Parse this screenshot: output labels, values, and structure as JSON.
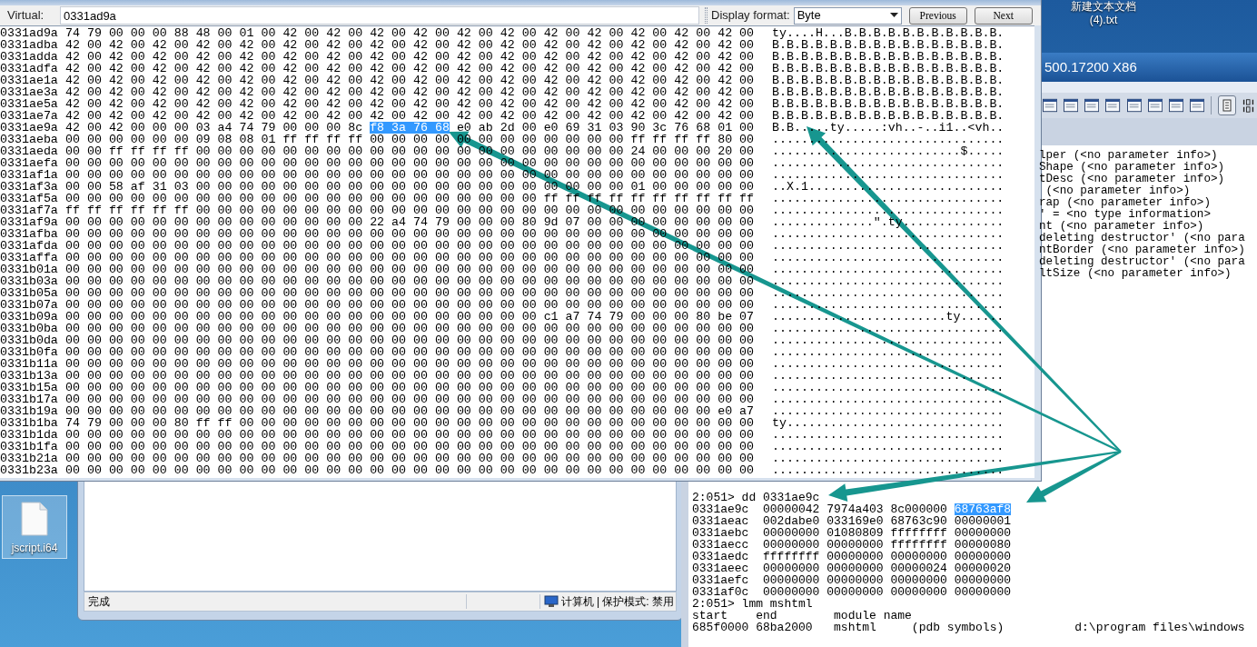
{
  "desktop_icons": [
    {
      "label_lines": [
        "新建文本文档",
        "(4).txt"
      ]
    }
  ],
  "debugger": {
    "title": "500.17200 X86",
    "symbol_lines": [
      "lper (<no parameter info>)",
      "Shape (<no parameter info>)",
      "tDesc (<no parameter info>)",
      " (<no parameter info>)",
      "rap (<no parameter info>)",
      "' = <no type information>",
      "nt (<no parameter info>)",
      "deleting destructor' (<no para",
      "ntBorder (<no parameter info>)",
      "deleting destructor' (<no para",
      "ltSize (<no parameter info>)"
    ],
    "command_lines": [
      {
        "kind": "prompt",
        "text": "2:051> dd 0331ae9c"
      },
      {
        "kind": "dump",
        "address": "0331ae9c",
        "values": [
          {
            "text": "00000042",
            "selected": false
          },
          {
            "text": "7974a403",
            "selected": false
          },
          {
            "text": "8c000000",
            "selected": false
          },
          {
            "text": "68763af8",
            "selected": true
          }
        ]
      },
      {
        "kind": "dump",
        "address": "0331aeac",
        "values": [
          {
            "text": "002dabe0",
            "selected": false
          },
          {
            "text": "033169e0",
            "selected": false
          },
          {
            "text": "68763c90",
            "selected": false
          },
          {
            "text": "00000001",
            "selected": false
          }
        ]
      },
      {
        "kind": "dump",
        "address": "0331aebc",
        "values": [
          {
            "text": "00000000",
            "selected": false
          },
          {
            "text": "01080809",
            "selected": false
          },
          {
            "text": "ffffffff",
            "selected": false
          },
          {
            "text": "00000000",
            "selected": false
          }
        ]
      },
      {
        "kind": "dump",
        "address": "0331aecc",
        "values": [
          {
            "text": "00000000",
            "selected": false
          },
          {
            "text": "00000000",
            "selected": false
          },
          {
            "text": "ffffffff",
            "selected": false
          },
          {
            "text": "00000080",
            "selected": false
          }
        ]
      },
      {
        "kind": "dump",
        "address": "0331aedc",
        "values": [
          {
            "text": "ffffffff",
            "selected": false
          },
          {
            "text": "00000000",
            "selected": false
          },
          {
            "text": "00000000",
            "selected": false
          },
          {
            "text": "00000000",
            "selected": false
          }
        ]
      },
      {
        "kind": "dump",
        "address": "0331aeec",
        "values": [
          {
            "text": "00000000",
            "selected": false
          },
          {
            "text": "00000000",
            "selected": false
          },
          {
            "text": "00000024",
            "selected": false
          },
          {
            "text": "00000020",
            "selected": false
          }
        ]
      },
      {
        "kind": "dump",
        "address": "0331aefc",
        "values": [
          {
            "text": "00000000",
            "selected": false
          },
          {
            "text": "00000000",
            "selected": false
          },
          {
            "text": "00000000",
            "selected": false
          },
          {
            "text": "00000000",
            "selected": false
          }
        ]
      },
      {
        "kind": "dump",
        "address": "0331af0c",
        "values": [
          {
            "text": "00000000",
            "selected": false
          },
          {
            "text": "00000000",
            "selected": false
          },
          {
            "text": "00000000",
            "selected": false
          },
          {
            "text": "00000000",
            "selected": false
          }
        ]
      },
      {
        "kind": "prompt",
        "text": "2:051> lmm mshtml"
      },
      {
        "kind": "text",
        "text": "start    end        module name"
      },
      {
        "kind": "text",
        "text": "685f0000 68ba2000   mshtml     (pdb symbols)          d:\\program files\\windows"
      }
    ]
  },
  "browser_window": {
    "status": "完成",
    "zone": "计算机 | 保护模式: 禁用"
  },
  "desktop_icon": {
    "label": "jscript.i64",
    "selected": true
  },
  "memory_window": {
    "address_label": "Virtual:",
    "address_value": "0331ad9a",
    "format_label": "Display format:",
    "format_value": "Byte",
    "buttons": [
      "Previous",
      "Next"
    ],
    "rows": [
      {
        "address": "0331ad9a",
        "hex": [
          {
            "text": "74 79 00 00 00 88 48 00 01 00 42 00 42 00 42 00 42 00 42 00 42 00 42 00 42 00 42 00 42 00 42 00",
            "selected": false
          }
        ],
        "ascii": "ty....H...B.B.B.B.B.B.B.B.B.B.B."
      },
      {
        "address": "0331adba",
        "hex": [
          {
            "text": "42 00 42 00 42 00 42 00 42 00 42 00 42 00 42 00 42 00 42 00 42 00 42 00 42 00 42 00 42 00 42 00",
            "selected": false
          }
        ],
        "ascii": "B.B.B.B.B.B.B.B.B.B.B.B.B.B.B.B."
      },
      {
        "address": "0331adda",
        "hex": [
          {
            "text": "42 00 42 00 42 00 42 00 42 00 42 00 42 00 42 00 42 00 42 00 42 00 42 00 42 00 42 00 42 00 42 00",
            "selected": false
          }
        ],
        "ascii": "B.B.B.B.B.B.B.B.B.B.B.B.B.B.B.B."
      },
      {
        "address": "0331adfa",
        "hex": [
          {
            "text": "42 00 42 00 42 00 42 00 42 00 42 00 42 00 42 00 42 00 42 00 42 00 42 00 42 00 42 00 42 00 42 00",
            "selected": false
          }
        ],
        "ascii": "B.B.B.B.B.B.B.B.B.B.B.B.B.B.B.B."
      },
      {
        "address": "0331ae1a",
        "hex": [
          {
            "text": "42 00 42 00 42 00 42 00 42 00 42 00 42 00 42 00 42 00 42 00 42 00 42 00 42 00 42 00 42 00 42 00",
            "selected": false
          }
        ],
        "ascii": "B.B.B.B.B.B.B.B.B.B.B.B.B.B.B.B."
      },
      {
        "address": "0331ae3a",
        "hex": [
          {
            "text": "42 00 42 00 42 00 42 00 42 00 42 00 42 00 42 00 42 00 42 00 42 00 42 00 42 00 42 00 42 00 42 00",
            "selected": false
          }
        ],
        "ascii": "B.B.B.B.B.B.B.B.B.B.B.B.B.B.B.B."
      },
      {
        "address": "0331ae5a",
        "hex": [
          {
            "text": "42 00 42 00 42 00 42 00 42 00 42 00 42 00 42 00 42 00 42 00 42 00 42 00 42 00 42 00 42 00 42 00",
            "selected": false
          }
        ],
        "ascii": "B.B.B.B.B.B.B.B.B.B.B.B.B.B.B.B."
      },
      {
        "address": "0331ae7a",
        "hex": [
          {
            "text": "42 00 42 00 42 00 42 00 42 00 42 00 42 00 42 00 42 00 42 00 42 00 42 00 42 00 42 00 42 00 42 00",
            "selected": false
          }
        ],
        "ascii": "B.B.B.B.B.B.B.B.B.B.B.B.B.B.B.B."
      },
      {
        "address": "0331ae9a",
        "hex": [
          {
            "text": "42 00 42 00 00 00 03 a4 74 79 00 00 00 8c",
            "selected": false
          },
          {
            "text": "f8 3a 76 68",
            "selected": true
          },
          {
            "text": "e0 ab 2d 00 e0 69 31 03 90 3c 76 68 01 00",
            "selected": false
          }
        ],
        "ascii": "B.B.....ty.....:vh..-..i1..<vh.."
      },
      {
        "address": "0331aeba",
        "hex": [
          {
            "text": "00 00 00 00 00 00 09 08 08 01 ff ff ff ff 00 00 00 00 00 00 00 00 00 00 00 00 ff ff ff ff 80 00",
            "selected": false
          }
        ],
        "ascii": "................................"
      },
      {
        "address": "0331aeda",
        "hex": [
          {
            "text": "00 00 ff ff ff ff 00 00 00 00 00 00 00 00 00 00 00 00 00 00 00 00 00 00 00 00 24 00 00 00 20 00",
            "selected": false
          }
        ],
        "ascii": "..........................$....."
      },
      {
        "address": "0331aefa",
        "hex": [
          {
            "text": "00 00 00 00 00 00 00 00 00 00 00 00 00 00 00 00 00 00 00 00 00 00 00 00 00 00 00 00 00 00 00 00",
            "selected": false
          }
        ],
        "ascii": "................................"
      },
      {
        "address": "0331af1a",
        "hex": [
          {
            "text": "00 00 00 00 00 00 00 00 00 00 00 00 00 00 00 00 00 00 00 00 00 00 00 00 00 00 00 00 00 00 00 00",
            "selected": false
          }
        ],
        "ascii": "................................"
      },
      {
        "address": "0331af3a",
        "hex": [
          {
            "text": "00 00 58 af 31 03 00 00 00 00 00 00 00 00 00 00 00 00 00 00 00 00 00 00 00 00 01 00 00 00 00 00",
            "selected": false
          }
        ],
        "ascii": "..X.1..........................."
      },
      {
        "address": "0331af5a",
        "hex": [
          {
            "text": "00 00 00 00 00 00 00 00 00 00 00 00 00 00 00 00 00 00 00 00 00 00 ff ff ff ff ff ff ff ff ff ff",
            "selected": false
          }
        ],
        "ascii": "................................"
      },
      {
        "address": "0331af7a",
        "hex": [
          {
            "text": "ff ff ff ff ff ff 00 00 00 00 00 00 00 00 00 00 00 00 00 00 00 00 00 00 00 00 00 00 00 00 00 00",
            "selected": false
          }
        ],
        "ascii": "................................"
      },
      {
        "address": "0331af9a",
        "hex": [
          {
            "text": "00 00 00 00 00 00 00 00 00 00 00 00 00 00 22 a4 74 79 00 00 00 80 9d 07 00 00 00 00 00 00 00 00",
            "selected": false
          }
        ],
        "ascii": "..............\".ty.............."
      },
      {
        "address": "0331afba",
        "hex": [
          {
            "text": "00 00 00 00 00 00 00 00 00 00 00 00 00 00 00 00 00 00 00 00 00 00 00 00 00 00 00 00 00 00 00 00",
            "selected": false
          }
        ],
        "ascii": "................................"
      },
      {
        "address": "0331afda",
        "hex": [
          {
            "text": "00 00 00 00 00 00 00 00 00 00 00 00 00 00 00 00 00 00 00 00 00 00 00 00 00 00 00 00 00 00 00 00",
            "selected": false
          }
        ],
        "ascii": "................................"
      },
      {
        "address": "0331affa",
        "hex": [
          {
            "text": "00 00 00 00 00 00 00 00 00 00 00 00 00 00 00 00 00 00 00 00 00 00 00 00 00 00 00 00 00 00 00 00",
            "selected": false
          }
        ],
        "ascii": "................................"
      },
      {
        "address": "0331b01a",
        "hex": [
          {
            "text": "00 00 00 00 00 00 00 00 00 00 00 00 00 00 00 00 00 00 00 00 00 00 00 00 00 00 00 00 00 00 00 00",
            "selected": false
          }
        ],
        "ascii": "................................"
      },
      {
        "address": "0331b03a",
        "hex": [
          {
            "text": "00 00 00 00 00 00 00 00 00 00 00 00 00 00 00 00 00 00 00 00 00 00 00 00 00 00 00 00 00 00 00 00",
            "selected": false
          }
        ],
        "ascii": "................................"
      },
      {
        "address": "0331b05a",
        "hex": [
          {
            "text": "00 00 00 00 00 00 00 00 00 00 00 00 00 00 00 00 00 00 00 00 00 00 00 00 00 00 00 00 00 00 00 00",
            "selected": false
          }
        ],
        "ascii": "................................"
      },
      {
        "address": "0331b07a",
        "hex": [
          {
            "text": "00 00 00 00 00 00 00 00 00 00 00 00 00 00 00 00 00 00 00 00 00 00 00 00 00 00 00 00 00 00 00 00",
            "selected": false
          }
        ],
        "ascii": "................................"
      },
      {
        "address": "0331b09a",
        "hex": [
          {
            "text": "00 00 00 00 00 00 00 00 00 00 00 00 00 00 00 00 00 00 00 00 00 00 c1 a7 74 79 00 00 00 80 be 07",
            "selected": false
          }
        ],
        "ascii": "........................ty......"
      },
      {
        "address": "0331b0ba",
        "hex": [
          {
            "text": "00 00 00 00 00 00 00 00 00 00 00 00 00 00 00 00 00 00 00 00 00 00 00 00 00 00 00 00 00 00 00 00",
            "selected": false
          }
        ],
        "ascii": "................................"
      },
      {
        "address": "0331b0da",
        "hex": [
          {
            "text": "00 00 00 00 00 00 00 00 00 00 00 00 00 00 00 00 00 00 00 00 00 00 00 00 00 00 00 00 00 00 00 00",
            "selected": false
          }
        ],
        "ascii": "................................"
      },
      {
        "address": "0331b0fa",
        "hex": [
          {
            "text": "00 00 00 00 00 00 00 00 00 00 00 00 00 00 00 00 00 00 00 00 00 00 00 00 00 00 00 00 00 00 00 00",
            "selected": false
          }
        ],
        "ascii": "................................"
      },
      {
        "address": "0331b11a",
        "hex": [
          {
            "text": "00 00 00 00 00 00 00 00 00 00 00 00 00 00 00 00 00 00 00 00 00 00 00 00 00 00 00 00 00 00 00 00",
            "selected": false
          }
        ],
        "ascii": "................................"
      },
      {
        "address": "0331b13a",
        "hex": [
          {
            "text": "00 00 00 00 00 00 00 00 00 00 00 00 00 00 00 00 00 00 00 00 00 00 00 00 00 00 00 00 00 00 00 00",
            "selected": false
          }
        ],
        "ascii": "................................"
      },
      {
        "address": "0331b15a",
        "hex": [
          {
            "text": "00 00 00 00 00 00 00 00 00 00 00 00 00 00 00 00 00 00 00 00 00 00 00 00 00 00 00 00 00 00 00 00",
            "selected": false
          }
        ],
        "ascii": "................................"
      },
      {
        "address": "0331b17a",
        "hex": [
          {
            "text": "00 00 00 00 00 00 00 00 00 00 00 00 00 00 00 00 00 00 00 00 00 00 00 00 00 00 00 00 00 00 00 00",
            "selected": false
          }
        ],
        "ascii": "................................"
      },
      {
        "address": "0331b19a",
        "hex": [
          {
            "text": "00 00 00 00 00 00 00 00 00 00 00 00 00 00 00 00 00 00 00 00 00 00 00 00 00 00 00 00 00 00 e0 a7",
            "selected": false
          }
        ],
        "ascii": "................................"
      },
      {
        "address": "0331b1ba",
        "hex": [
          {
            "text": "74 79 00 00 00 80 ff ff 00 00 00 00 00 00 00 00 00 00 00 00 00 00 00 00 00 00 00 00 00 00 00 00",
            "selected": false
          }
        ],
        "ascii": "ty.............................."
      },
      {
        "address": "0331b1da",
        "hex": [
          {
            "text": "00 00 00 00 00 00 00 00 00 00 00 00 00 00 00 00 00 00 00 00 00 00 00 00 00 00 00 00 00 00 00 00",
            "selected": false
          }
        ],
        "ascii": "................................"
      },
      {
        "address": "0331b1fa",
        "hex": [
          {
            "text": "00 00 00 00 00 00 00 00 00 00 00 00 00 00 00 00 00 00 00 00 00 00 00 00 00 00 00 00 00 00 00 00",
            "selected": false
          }
        ],
        "ascii": "................................"
      },
      {
        "address": "0331b21a",
        "hex": [
          {
            "text": "00 00 00 00 00 00 00 00 00 00 00 00 00 00 00 00 00 00 00 00 00 00 00 00 00 00 00 00 00 00 00 00",
            "selected": false
          }
        ],
        "ascii": "................................"
      },
      {
        "address": "0331b23a",
        "hex": [
          {
            "text": "00 00 00 00 00 00 00 00 00 00 00 00 00 00 00 00 00 00 00 00 00 00 00 00 00 00 00 00 00 00 00 00",
            "selected": false
          }
        ],
        "ascii": "................................"
      }
    ]
  }
}
